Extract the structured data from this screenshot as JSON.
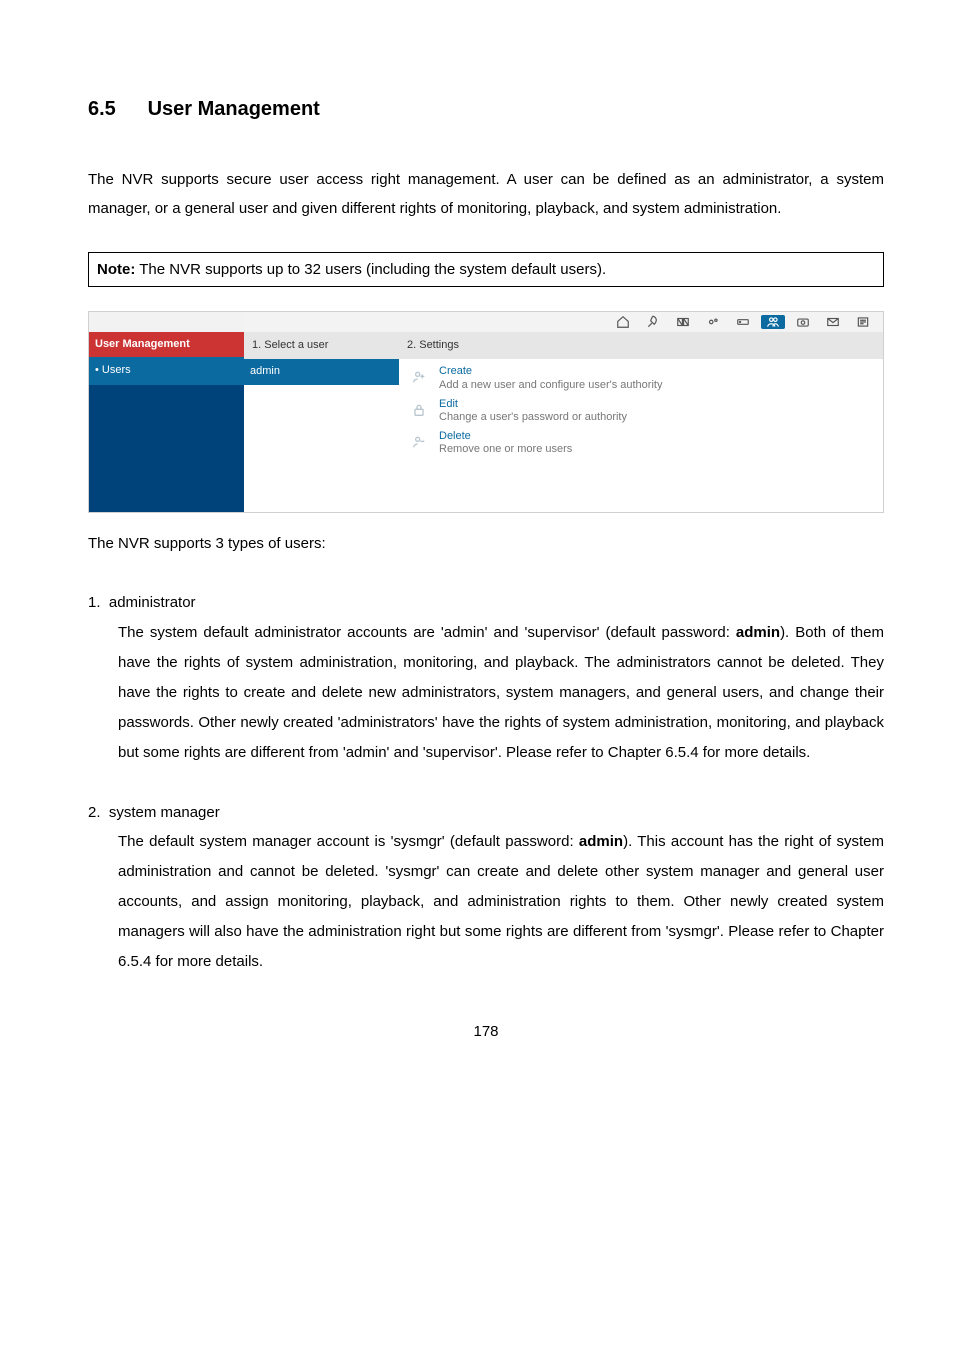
{
  "section": {
    "number": "6.5",
    "title": "User Management"
  },
  "intro": "The NVR supports secure user access right management.   A user can be defined as an administrator, a system manager, or a general user and given different rights of monitoring, playback, and system administration.",
  "note": {
    "label": "Note:",
    "text": " The NVR supports up to 32 users (including the system default users)."
  },
  "app": {
    "sidebar": {
      "heading": "User Management",
      "items": [
        "• Users"
      ]
    },
    "col_select": {
      "heading": "1. Select a user",
      "users": [
        "admin"
      ]
    },
    "col_settings": {
      "heading": "2. Settings",
      "items": [
        {
          "title": "Create",
          "desc": "Add a new user and configure user's authority"
        },
        {
          "title": "Edit",
          "desc": "Change a user's password or authority"
        },
        {
          "title": "Delete",
          "desc": "Remove one or more users"
        }
      ]
    },
    "toolbar_icons": [
      "home-icon",
      "rocket-icon",
      "folders-icon",
      "gears-icon",
      "drive-icon",
      "users-icon",
      "camera-icon",
      "envelope-icon",
      "logs-icon"
    ]
  },
  "caption": "The NVR supports 3 types of users:",
  "list": [
    {
      "num": "1.",
      "title": "administrator",
      "body": "The system default administrator accounts are 'admin' and 'supervisor' (default password: <b>admin</b>).   Both of them have the rights of system administration, monitoring, and playback.   The administrators cannot be deleted.   They have the rights to create and delete new administrators, system managers, and general users, and change their passwords.   Other newly created 'administrators' have the rights of system administration, monitoring, and playback but some rights are different from 'admin' and 'supervisor'.   Please refer to Chapter 6.5.4 for more details."
    },
    {
      "num": "2.",
      "title": "system manager",
      "body": "The default system manager account is 'sysmgr' (default password: <b>admin</b>).   This account has the right of system administration and cannot be deleted.   'sysmgr' can create and delete other system manager and general user accounts, and assign monitoring, playback, and administration rights to them.   Other newly created system managers will also have the administration right but some rights are different from 'sysmgr'.   Please refer to Chapter 6.5.4 for more details."
    }
  ],
  "page_number": "178"
}
